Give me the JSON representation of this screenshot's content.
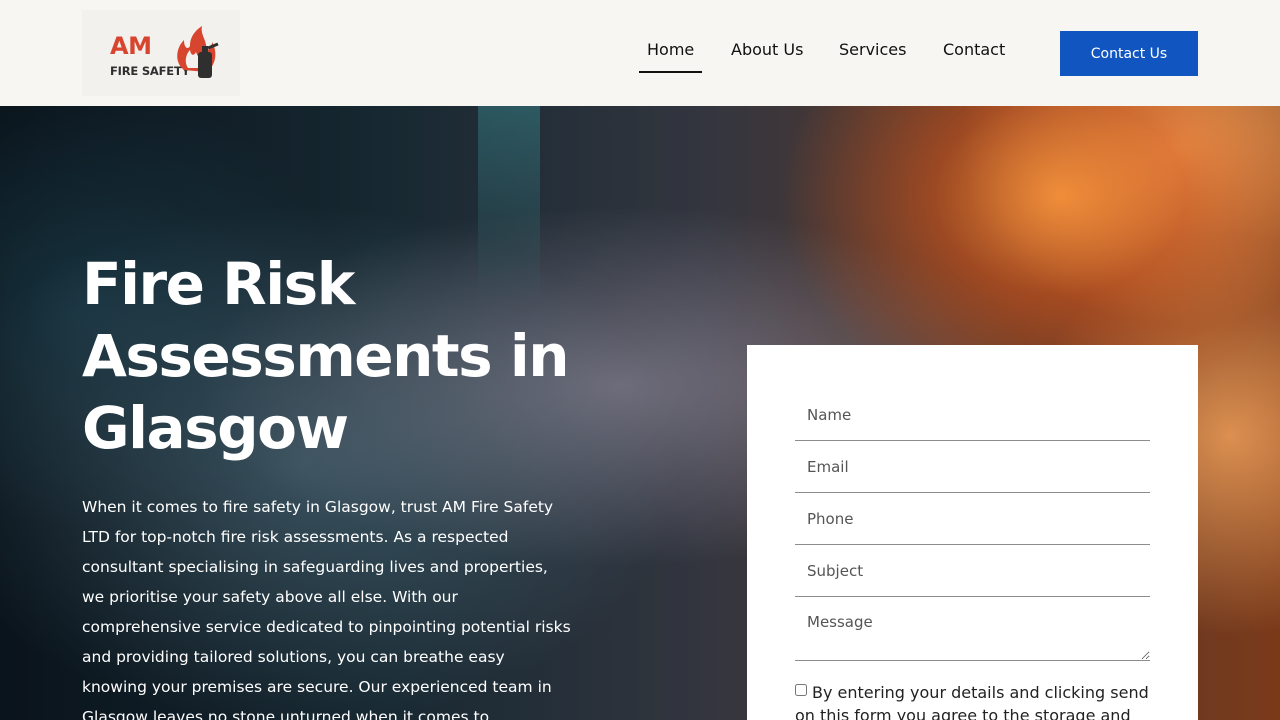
{
  "brand": {
    "logo_line1": "AM",
    "logo_line2": "FIRE SAFETY",
    "accent_color": "#d8452f",
    "button_color": "#1155c0"
  },
  "nav": {
    "items": [
      {
        "label": "Home",
        "active": true
      },
      {
        "label": "About Us",
        "active": false
      },
      {
        "label": "Services",
        "active": false
      },
      {
        "label": "Contact",
        "active": false
      }
    ],
    "cta_label": "Contact Us"
  },
  "hero": {
    "title_line1": "Fire Risk",
    "title_line2": "Assessments in",
    "title_line3": "Glasgow",
    "body": "When it comes to fire safety in Glasgow, trust AM Fire Safety LTD for top-notch fire risk assessments. As a respected consultant specialising in safeguarding lives and properties, we prioritise your safety above all else. With our comprehensive service dedicated to pinpointing potential risks and providing tailored solutions, you can breathe easy knowing your premises are secure. Our experienced team in Glasgow leaves no stone unturned when it comes to"
  },
  "form": {
    "name_placeholder": "Name",
    "email_placeholder": "Email",
    "phone_placeholder": "Phone",
    "subject_placeholder": "Subject",
    "message_placeholder": "Message",
    "consent_text": "By entering your details and clicking send on this form you agree to the storage and"
  }
}
